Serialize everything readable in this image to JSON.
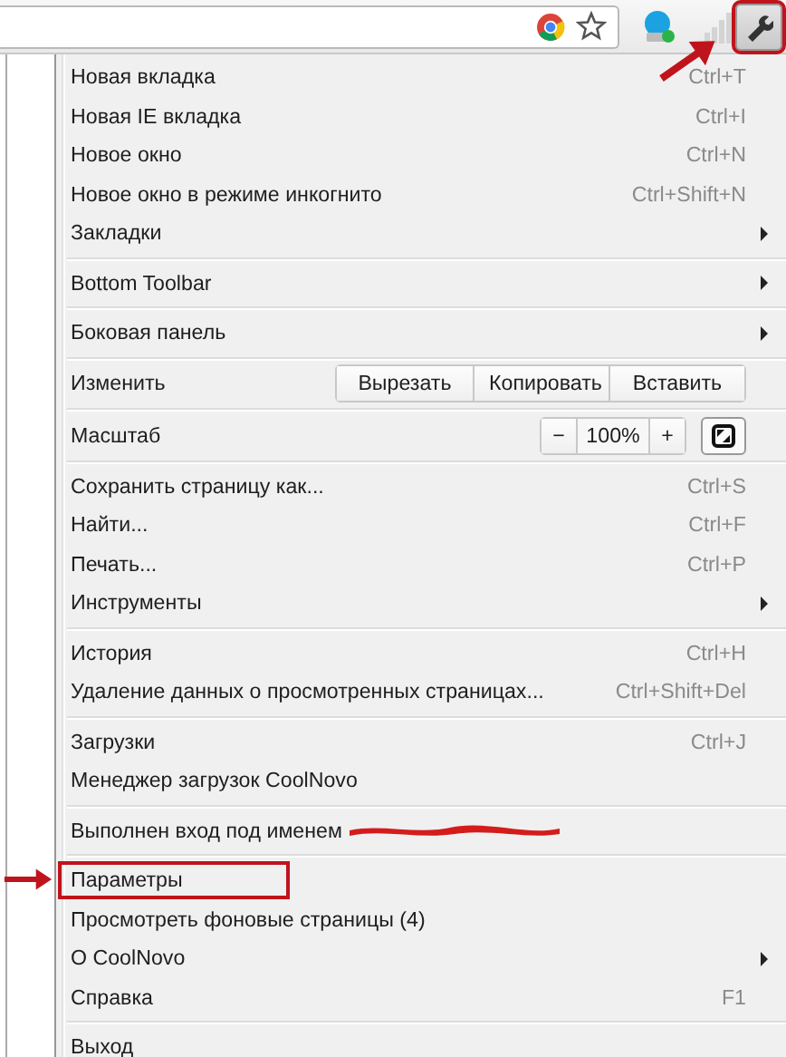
{
  "toolbar": {
    "menu_button": {
      "annotated": true
    }
  },
  "menu": [
    {
      "kind": "item",
      "label": "Новая вкладка",
      "shortcut": "Ctrl+T",
      "submenu": false,
      "annotated": false,
      "redacted": false
    },
    {
      "kind": "item",
      "label": "Новая IE вкладка",
      "shortcut": "Ctrl+I",
      "submenu": false,
      "annotated": false,
      "redacted": false
    },
    {
      "kind": "item",
      "label": "Новое окно",
      "shortcut": "Ctrl+N",
      "submenu": false,
      "annotated": false,
      "redacted": false
    },
    {
      "kind": "item",
      "label": "Новое окно в режиме инкогнито",
      "shortcut": "Ctrl+Shift+N",
      "submenu": false,
      "annotated": false,
      "redacted": false
    },
    {
      "kind": "item",
      "label": "Закладки",
      "submenu": true,
      "annotated": false,
      "redacted": false
    },
    {
      "kind": "separator"
    },
    {
      "kind": "item",
      "label": "Bottom Toolbar",
      "submenu": true,
      "annotated": false,
      "redacted": false
    },
    {
      "kind": "separator"
    },
    {
      "kind": "item",
      "label": "Боковая панель",
      "submenu": true,
      "annotated": false,
      "redacted": false
    },
    {
      "kind": "separator"
    },
    {
      "kind": "edit",
      "label": "Изменить",
      "buttons": [
        "Вырезать",
        "Копировать",
        "Вставить"
      ]
    },
    {
      "kind": "separator"
    },
    {
      "kind": "zoom",
      "label": "Масштаб",
      "minus": "−",
      "value": "100%",
      "plus": "+"
    },
    {
      "kind": "separator"
    },
    {
      "kind": "item",
      "label": "Сохранить страницу как...",
      "shortcut": "Ctrl+S",
      "submenu": false,
      "annotated": false,
      "redacted": false
    },
    {
      "kind": "item",
      "label": "Найти...",
      "shortcut": "Ctrl+F",
      "submenu": false,
      "annotated": false,
      "redacted": false
    },
    {
      "kind": "item",
      "label": "Печать...",
      "shortcut": "Ctrl+P",
      "submenu": false,
      "annotated": false,
      "redacted": false
    },
    {
      "kind": "item",
      "label": "Инструменты",
      "submenu": true,
      "annotated": false,
      "redacted": false
    },
    {
      "kind": "separator"
    },
    {
      "kind": "item",
      "label": "История",
      "shortcut": "Ctrl+H",
      "submenu": false,
      "annotated": false,
      "redacted": false
    },
    {
      "kind": "item",
      "label": "Удаление данных о просмотренных страницах...",
      "shortcut": "Ctrl+Shift+Del",
      "submenu": false,
      "annotated": false,
      "redacted": false
    },
    {
      "kind": "separator"
    },
    {
      "kind": "item",
      "label": "Загрузки",
      "shortcut": "Ctrl+J",
      "submenu": false,
      "annotated": false,
      "redacted": false
    },
    {
      "kind": "item",
      "label": "Менеджер загрузок CoolNovo",
      "submenu": false,
      "annotated": false,
      "redacted": false
    },
    {
      "kind": "separator"
    },
    {
      "kind": "item",
      "label": "Выполнен вход под именем",
      "submenu": false,
      "annotated": false,
      "redacted": true
    },
    {
      "kind": "separator"
    },
    {
      "kind": "item",
      "label": "Параметры",
      "submenu": false,
      "annotated": true,
      "redacted": false
    },
    {
      "kind": "item",
      "label": "Просмотреть фоновые страницы (4)",
      "submenu": false,
      "annotated": false,
      "redacted": false
    },
    {
      "kind": "item",
      "label": "О CoolNovo",
      "submenu": true,
      "annotated": false,
      "redacted": false
    },
    {
      "kind": "item",
      "label": "Справка",
      "shortcut": "F1",
      "submenu": false,
      "annotated": false,
      "redacted": false
    },
    {
      "kind": "separator"
    },
    {
      "kind": "item",
      "label": "Выход",
      "submenu": false,
      "annotated": false,
      "redacted": false
    }
  ]
}
